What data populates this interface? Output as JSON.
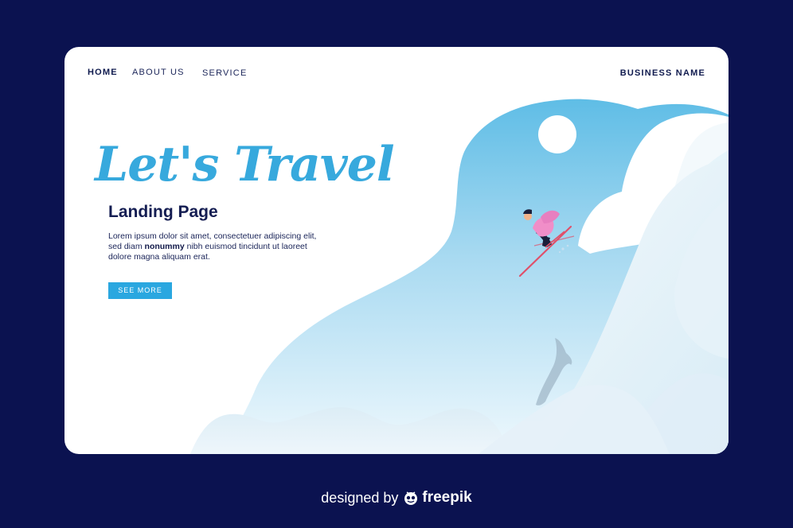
{
  "nav": {
    "home": "HOME",
    "about": "ABOUT US",
    "service": "SERVICE",
    "business": "BUSINESS NAME"
  },
  "hero": {
    "title": "Let's Travel",
    "subtitle": "Landing Page",
    "body_before": "Lorem ipsum dolor sit amet, consectetuer adipiscing elit, sed diam ",
    "body_bold": "nonummy",
    "body_after": " nibh euismod tincidunt ut laoreet dolore magna aliquam erat.",
    "cta": "SEE MORE"
  },
  "footer": {
    "designed_by": "designed by",
    "brand": "freepik"
  },
  "colors": {
    "background": "#0b1250",
    "card": "#ffffff",
    "accent": "#37a9dd",
    "button": "#2aa7e0",
    "text_dark": "#141d52"
  },
  "icons": [
    "freepik-logo-icon",
    "skier-illustration",
    "sun-icon"
  ]
}
